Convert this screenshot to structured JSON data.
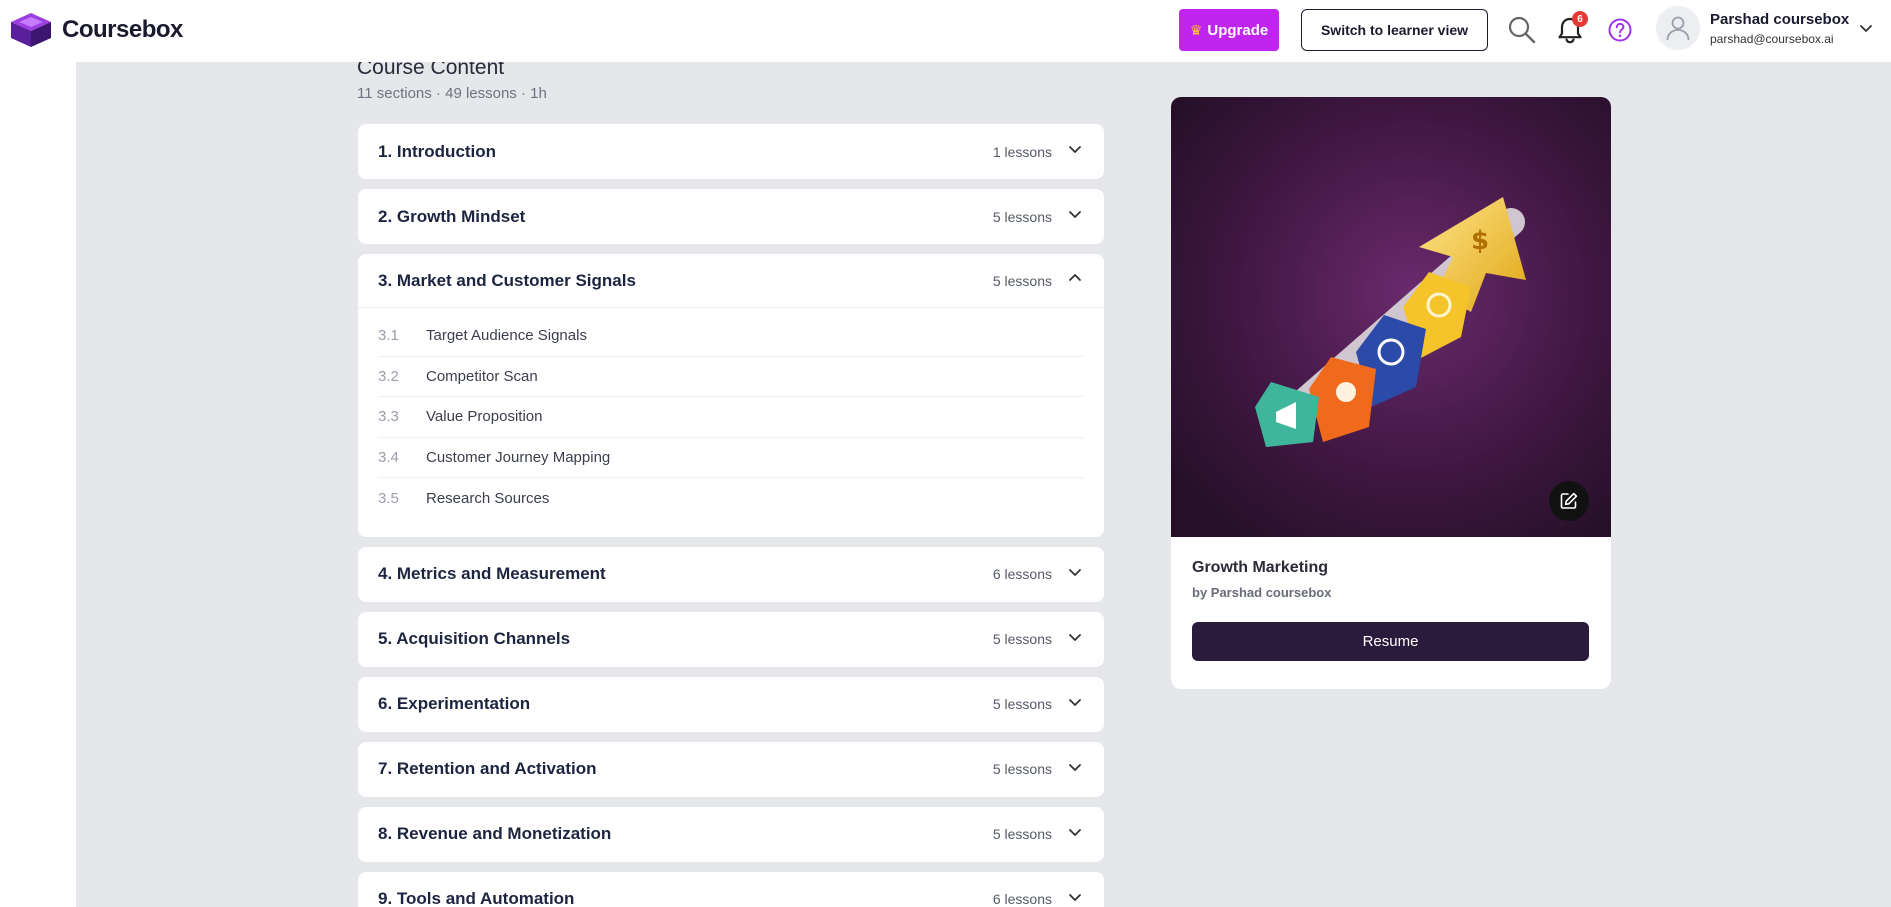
{
  "brand": {
    "name": "Coursebox",
    "accent": "#c025f0",
    "dark": "#2a1b3d"
  },
  "header": {
    "upgrade_label": "Upgrade",
    "learner_view_label": "Switch to learner view",
    "notification_count": "6",
    "user": {
      "name": "Parshad coursebox",
      "email": "parshad@coursebox.ai"
    },
    "icons": [
      "search-icon",
      "bell-icon",
      "help-icon",
      "user-icon",
      "chevron-down-icon"
    ]
  },
  "course_content": {
    "title": "Course Content",
    "meta": "11 sections · 49 lessons · 1h",
    "sections": [
      {
        "title": "1. Introduction",
        "count": "1 lessons",
        "open": false
      },
      {
        "title": "2. Growth Mindset",
        "count": "5 lessons",
        "open": false
      },
      {
        "title": "3. Market and Customer Signals",
        "count": "5 lessons",
        "open": true,
        "lessons": [
          {
            "num": "3.1",
            "title": "Target Audience Signals"
          },
          {
            "num": "3.2",
            "title": "Competitor Scan"
          },
          {
            "num": "3.3",
            "title": "Value Proposition"
          },
          {
            "num": "3.4",
            "title": "Customer Journey Mapping"
          },
          {
            "num": "3.5",
            "title": "Research Sources"
          }
        ]
      },
      {
        "title": "4. Metrics and Measurement",
        "count": "6 lessons",
        "open": false
      },
      {
        "title": "5. Acquisition Channels",
        "count": "5 lessons",
        "open": false
      },
      {
        "title": "6. Experimentation",
        "count": "5 lessons",
        "open": false
      },
      {
        "title": "7. Retention and Activation",
        "count": "5 lessons",
        "open": false
      },
      {
        "title": "8. Revenue and Monetization",
        "count": "5 lessons",
        "open": false
      },
      {
        "title": "9. Tools and Automation",
        "count": "6 lessons",
        "open": false
      }
    ]
  },
  "course_card": {
    "title": "Growth Marketing",
    "author": "by Parshad coursebox",
    "resume_label": "Resume"
  }
}
